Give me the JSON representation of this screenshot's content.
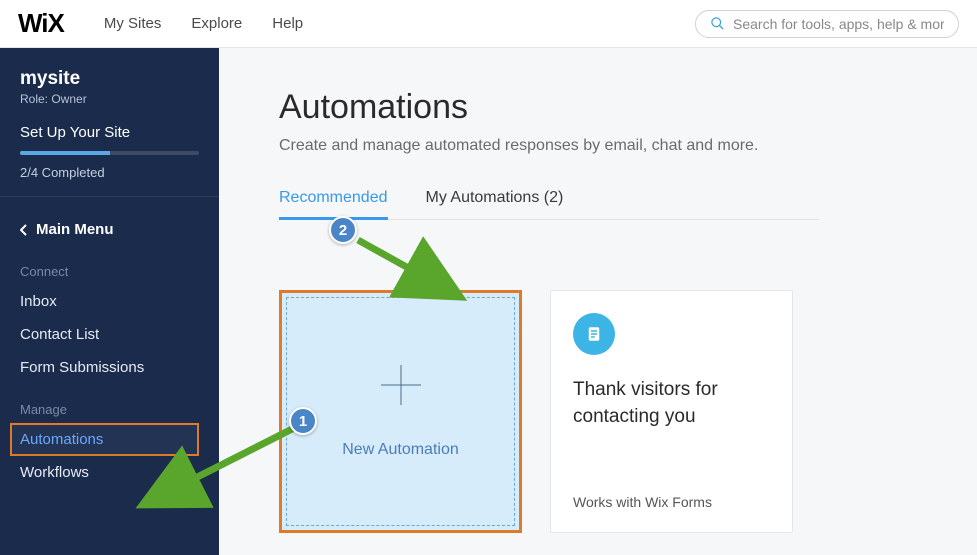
{
  "topbar": {
    "logo": "WiX",
    "nav": [
      "My Sites",
      "Explore",
      "Help"
    ],
    "search_placeholder": "Search for tools, apps, help & more..."
  },
  "sidebar": {
    "site_name": "mysite",
    "role_label": "Role: Owner",
    "setup_label": "Set Up Your Site",
    "progress_pct": 50,
    "completed_label": "2/4 Completed",
    "back_label": "Main Menu",
    "sections": {
      "connect": {
        "heading": "Connect",
        "items": [
          "Inbox",
          "Contact List",
          "Form Submissions"
        ]
      },
      "manage": {
        "heading": "Manage",
        "items": [
          "Automations",
          "Workflows"
        ],
        "active": "Automations"
      }
    }
  },
  "main": {
    "title": "Automations",
    "subtitle": "Create and manage automated responses by email, chat and more.",
    "tabs": {
      "recommended": "Recommended",
      "my_automations": "My Automations (2)"
    },
    "new_card_label": "New Automation",
    "reco": {
      "title": "Thank visitors for contacting you",
      "footer": "Works with Wix Forms"
    }
  },
  "annotations": {
    "one": "1",
    "two": "2"
  }
}
